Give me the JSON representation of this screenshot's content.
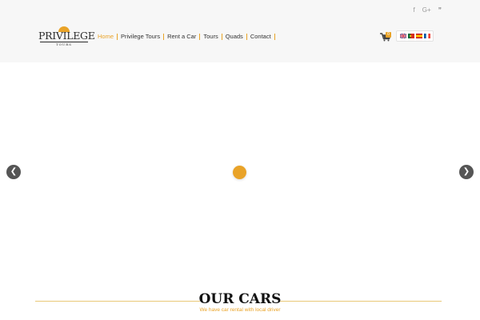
{
  "header": {
    "social": [
      {
        "icon": "facebook-icon",
        "glyph": "f"
      },
      {
        "icon": "google-plus-icon",
        "glyph": "G+"
      },
      {
        "icon": "twitter-icon",
        "glyph": "❞"
      }
    ],
    "logo": {
      "title": "PRIVILEGE",
      "subtitle": "TOURS"
    },
    "nav": [
      {
        "label": "Home",
        "active": true
      },
      {
        "label": "Privilege Tours"
      },
      {
        "label": "Rent a Car"
      },
      {
        "label": "Tours"
      },
      {
        "label": "Quads"
      },
      {
        "label": "Contact"
      }
    ],
    "cart": {
      "icon": "shopping-cart-icon",
      "count": "0"
    },
    "languages": [
      "English",
      "Portuguese",
      "Spanish",
      "French"
    ]
  },
  "slider": {
    "prev_icon": "❮",
    "next_icon": "❯"
  },
  "section": {
    "title": "OUR CARS",
    "subtitle": "We have car rental with local driver"
  },
  "colors": {
    "accent": "#e9a328",
    "header_bg": "#f7f7f7",
    "arrow_bg": "#555555"
  }
}
